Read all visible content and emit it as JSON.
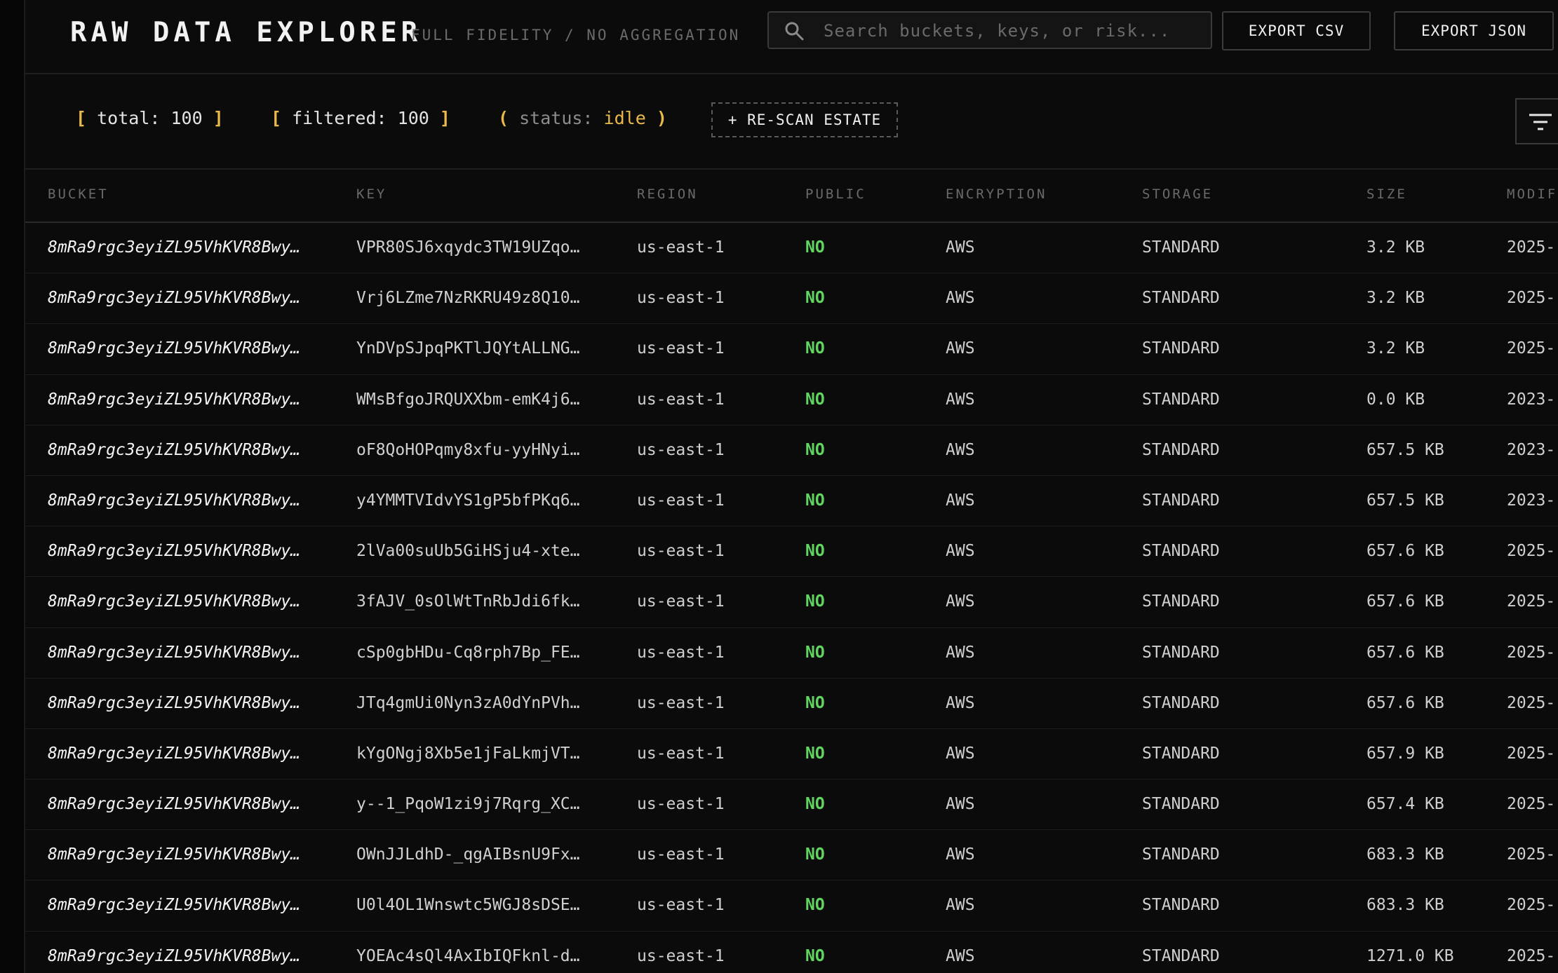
{
  "header": {
    "title": "RAW DATA EXPLORER",
    "subtitle": "FULL FIDELITY / NO AGGREGATION",
    "search_placeholder": "Search buckets, keys, or risk...",
    "export_csv_label": "EXPORT CSV",
    "export_json_label": "EXPORT JSON"
  },
  "toolbar": {
    "total_label": "total:",
    "total_value": "100",
    "filtered_label": "filtered:",
    "filtered_value": "100",
    "status_label": "status:",
    "status_value": "idle",
    "rescan_label": "+ RE-SCAN ESTATE",
    "filter_icon": "filter-icon"
  },
  "colors": {
    "accent": "#e9b949",
    "public_no": "#5fd65f",
    "background": "#0b0b0b"
  },
  "table": {
    "columns": [
      "BUCKET",
      "KEY",
      "REGION",
      "PUBLIC",
      "ENCRYPTION",
      "STORAGE",
      "SIZE",
      "MODIF"
    ],
    "rows": [
      {
        "bucket": "8mRa9rgc3eyiZL95VhKVR8Bwy…",
        "key": "VPR80SJ6xqydc3TW19UZqo…",
        "region": "us-east-1",
        "public": "NO",
        "encryption": "AWS",
        "storage": "STANDARD",
        "size": "3.2 KB",
        "modified": "2025-"
      },
      {
        "bucket": "8mRa9rgc3eyiZL95VhKVR8Bwy…",
        "key": "Vrj6LZme7NzRKRU49z8Q10…",
        "region": "us-east-1",
        "public": "NO",
        "encryption": "AWS",
        "storage": "STANDARD",
        "size": "3.2 KB",
        "modified": "2025-"
      },
      {
        "bucket": "8mRa9rgc3eyiZL95VhKVR8Bwy…",
        "key": "YnDVpSJpqPKTlJQYtALLNG…",
        "region": "us-east-1",
        "public": "NO",
        "encryption": "AWS",
        "storage": "STANDARD",
        "size": "3.2 KB",
        "modified": "2025-"
      },
      {
        "bucket": "8mRa9rgc3eyiZL95VhKVR8Bwy…",
        "key": "WMsBfgoJRQUXXbm-emK4j6…",
        "region": "us-east-1",
        "public": "NO",
        "encryption": "AWS",
        "storage": "STANDARD",
        "size": "0.0 KB",
        "modified": "2023-"
      },
      {
        "bucket": "8mRa9rgc3eyiZL95VhKVR8Bwy…",
        "key": "oF8QoHOPqmy8xfu-yyHNyi…",
        "region": "us-east-1",
        "public": "NO",
        "encryption": "AWS",
        "storage": "STANDARD",
        "size": "657.5 KB",
        "modified": "2023-"
      },
      {
        "bucket": "8mRa9rgc3eyiZL95VhKVR8Bwy…",
        "key": "y4YMMTVIdvYS1gP5bfPKq6…",
        "region": "us-east-1",
        "public": "NO",
        "encryption": "AWS",
        "storage": "STANDARD",
        "size": "657.5 KB",
        "modified": "2023-"
      },
      {
        "bucket": "8mRa9rgc3eyiZL95VhKVR8Bwy…",
        "key": "2lVa00suUb5GiHSju4-xte…",
        "region": "us-east-1",
        "public": "NO",
        "encryption": "AWS",
        "storage": "STANDARD",
        "size": "657.6 KB",
        "modified": "2025-"
      },
      {
        "bucket": "8mRa9rgc3eyiZL95VhKVR8Bwy…",
        "key": "3fAJV_0sOlWtTnRbJdi6fk…",
        "region": "us-east-1",
        "public": "NO",
        "encryption": "AWS",
        "storage": "STANDARD",
        "size": "657.6 KB",
        "modified": "2025-"
      },
      {
        "bucket": "8mRa9rgc3eyiZL95VhKVR8Bwy…",
        "key": "cSp0gbHDu-Cq8rph7Bp_FE…",
        "region": "us-east-1",
        "public": "NO",
        "encryption": "AWS",
        "storage": "STANDARD",
        "size": "657.6 KB",
        "modified": "2025-"
      },
      {
        "bucket": "8mRa9rgc3eyiZL95VhKVR8Bwy…",
        "key": "JTq4gmUi0Nyn3zA0dYnPVh…",
        "region": "us-east-1",
        "public": "NO",
        "encryption": "AWS",
        "storage": "STANDARD",
        "size": "657.6 KB",
        "modified": "2025-"
      },
      {
        "bucket": "8mRa9rgc3eyiZL95VhKVR8Bwy…",
        "key": "kYgONgj8Xb5e1jFaLkmjVT…",
        "region": "us-east-1",
        "public": "NO",
        "encryption": "AWS",
        "storage": "STANDARD",
        "size": "657.9 KB",
        "modified": "2025-"
      },
      {
        "bucket": "8mRa9rgc3eyiZL95VhKVR8Bwy…",
        "key": "y--1_PqoW1zi9j7Rqrg_XC…",
        "region": "us-east-1",
        "public": "NO",
        "encryption": "AWS",
        "storage": "STANDARD",
        "size": "657.4 KB",
        "modified": "2025-"
      },
      {
        "bucket": "8mRa9rgc3eyiZL95VhKVR8Bwy…",
        "key": "OWnJJLdhD-_qgAIBsnU9Fx…",
        "region": "us-east-1",
        "public": "NO",
        "encryption": "AWS",
        "storage": "STANDARD",
        "size": "683.3 KB",
        "modified": "2025-"
      },
      {
        "bucket": "8mRa9rgc3eyiZL95VhKVR8Bwy…",
        "key": "U0l4OL1Wnswtc5WGJ8sDSE…",
        "region": "us-east-1",
        "public": "NO",
        "encryption": "AWS",
        "storage": "STANDARD",
        "size": "683.3 KB",
        "modified": "2025-"
      },
      {
        "bucket": "8mRa9rgc3eyiZL95VhKVR8Bwy…",
        "key": "YOEAc4sQl4AxIbIQFknl-d…",
        "region": "us-east-1",
        "public": "NO",
        "encryption": "AWS",
        "storage": "STANDARD",
        "size": "1271.0 KB",
        "modified": "2025-"
      }
    ]
  }
}
